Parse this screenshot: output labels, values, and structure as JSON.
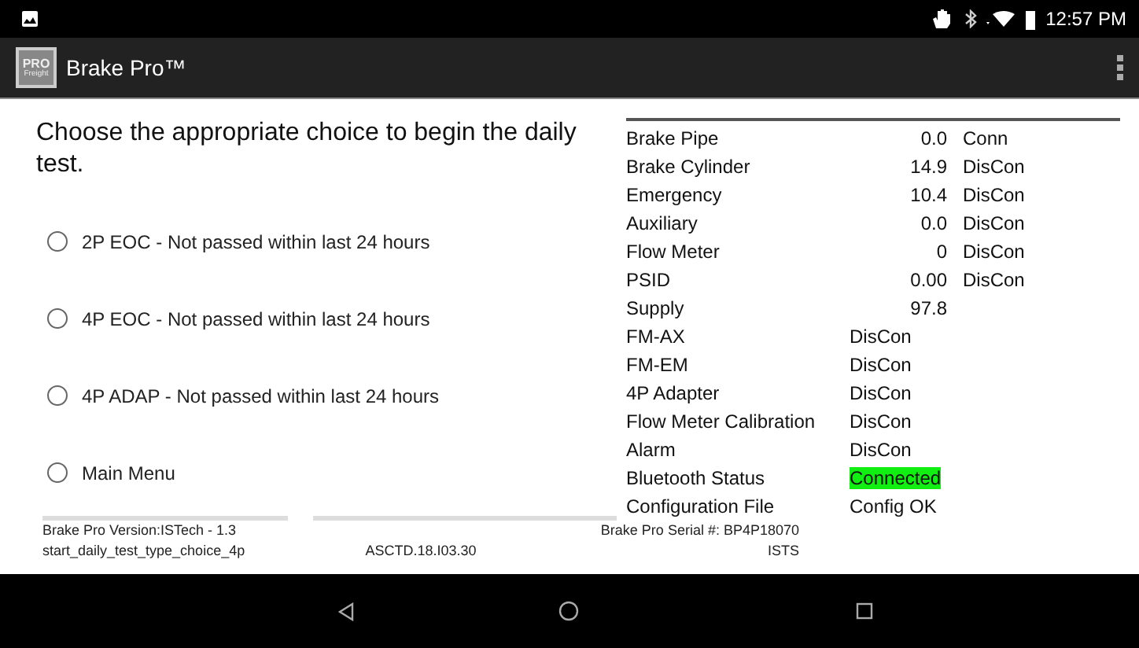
{
  "status_bar": {
    "time": "12:57 PM"
  },
  "app_bar": {
    "title": "Brake Pro™",
    "logo_text": [
      "PRO",
      "Freight"
    ]
  },
  "prompt": "Choose the appropriate choice to begin the daily test.",
  "choices": [
    {
      "label": "2P EOC - Not passed within last 24 hours",
      "selected": false
    },
    {
      "label": "4P EOC - Not passed within last 24 hours",
      "selected": false
    },
    {
      "label": "4P ADAP - Not passed within last 24 hours",
      "selected": false
    },
    {
      "label": "Main Menu",
      "selected": false
    }
  ],
  "readings": [
    {
      "kind": "reading",
      "label": "Brake Pipe",
      "value": "0.0",
      "status": "Conn",
      "highlighted": false
    },
    {
      "kind": "reading",
      "label": "Brake Cylinder",
      "value": "14.9",
      "status": "DisCon",
      "highlighted": false
    },
    {
      "kind": "reading",
      "label": "Emergency",
      "value": "10.4",
      "status": "DisCon",
      "highlighted": false
    },
    {
      "kind": "reading",
      "label": "Auxiliary",
      "value": "0.0",
      "status": "DisCon",
      "highlighted": false
    },
    {
      "kind": "reading",
      "label": "Flow Meter",
      "value": "0",
      "status": "DisCon",
      "highlighted": false
    },
    {
      "kind": "reading",
      "label": "PSID",
      "value": "0.00",
      "status": "DisCon",
      "highlighted": false
    },
    {
      "kind": "reading",
      "label": "Supply",
      "value": "97.8",
      "highlighted": false
    },
    {
      "kind": "state",
      "label": "FM-AX",
      "status": "DisCon",
      "highlighted": false
    },
    {
      "kind": "state",
      "label": "FM-EM",
      "status": "DisCon",
      "highlighted": false
    },
    {
      "kind": "state",
      "label": "4P Adapter",
      "status": "DisCon",
      "highlighted": false
    },
    {
      "kind": "state",
      "label": "Flow Meter Calibration",
      "status": "DisCon",
      "highlighted": false
    },
    {
      "kind": "state",
      "label": "Alarm",
      "status": "DisCon",
      "highlighted": false
    },
    {
      "kind": "state",
      "label": "Bluetooth Status",
      "status": "Connected",
      "highlighted": true
    },
    {
      "kind": "state",
      "label": "Configuration File",
      "status": "Config OK",
      "highlighted": false
    }
  ],
  "footer": {
    "version": "Brake Pro Version:ISTech - 1.3",
    "serial": "Brake Pro Serial #: BP4P18070",
    "screen_id": "start_daily_test_type_choice_4p",
    "build": "ASCTD.18.I03.30",
    "company": "ISTS"
  }
}
